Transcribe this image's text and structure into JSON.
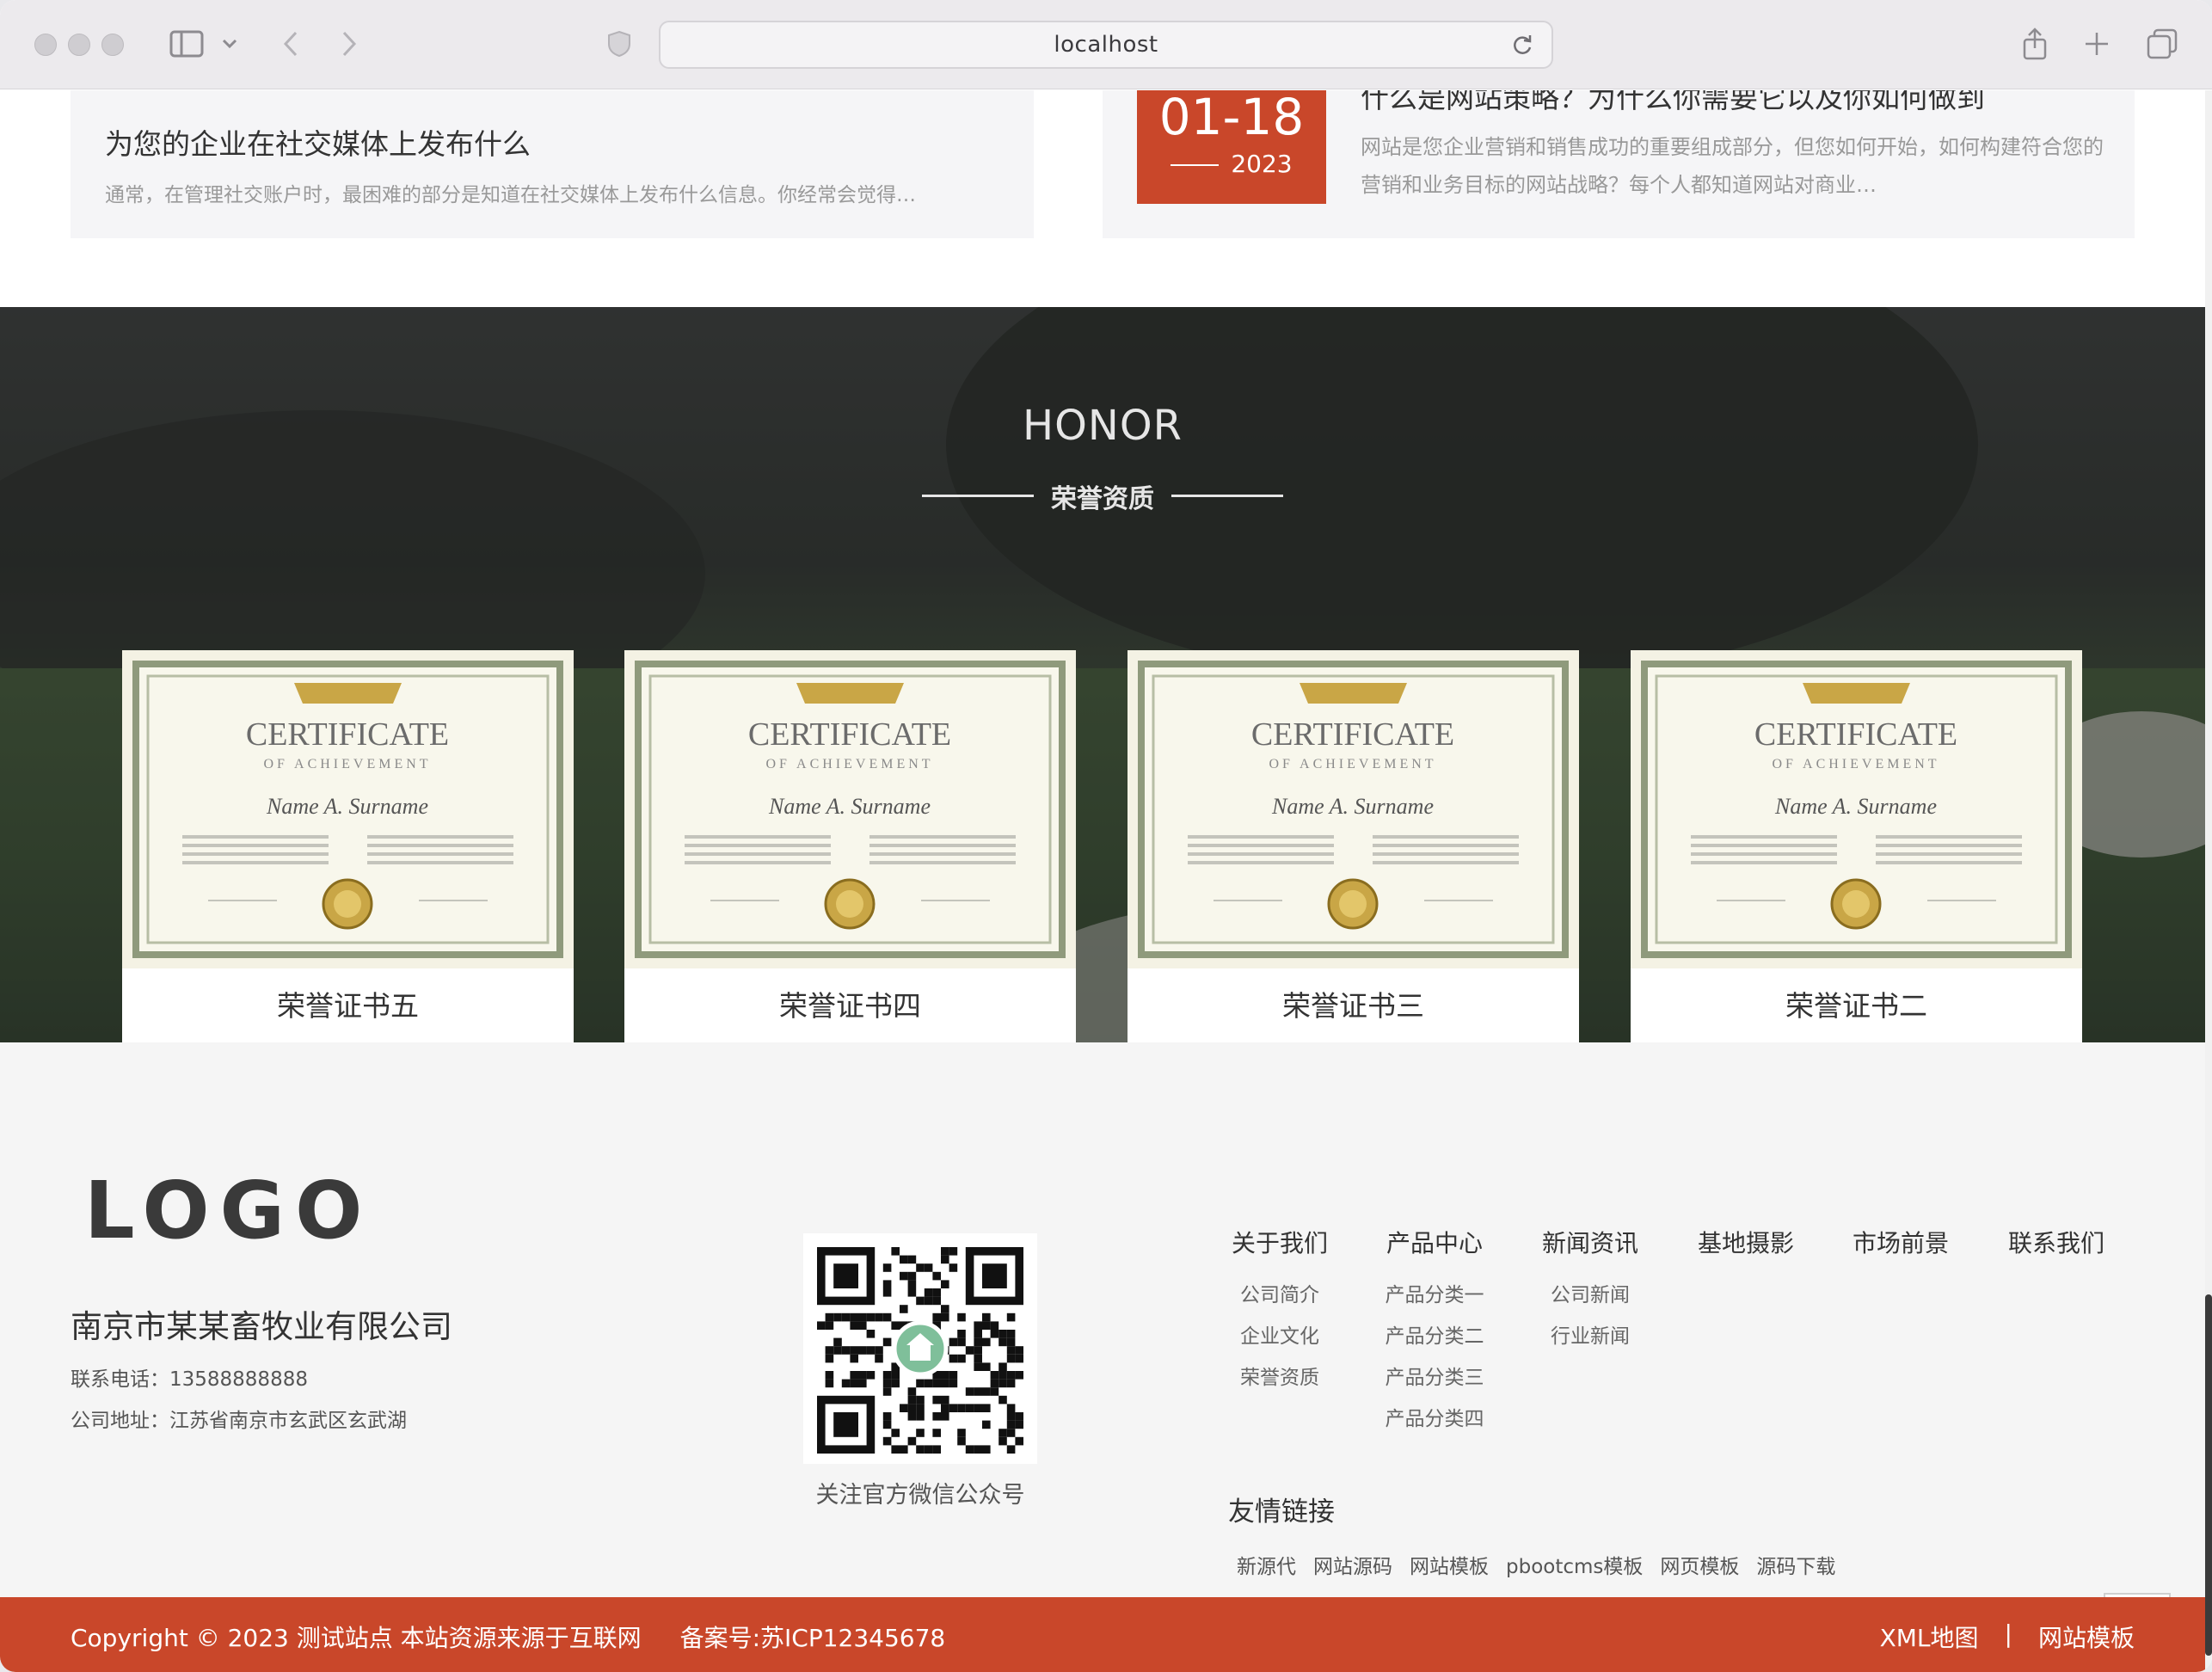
{
  "browser": {
    "url": "localhost"
  },
  "news": {
    "left": {
      "title": "为您的企业在社交媒体上发布什么",
      "desc": "通常，在管理社交账户时，最困难的部分是知道在社交媒体上发布什么信息。你经常会觉得…"
    },
    "right": {
      "date_md": "01-18",
      "date_year": "2023",
      "title": "什么是网站策略？为什么你需要它以及你如何做到",
      "desc": "网站是您企业营销和销售成功的重要组成部分，但您如何开始，如何构建符合您的营销和业务目标的网站战略？每个人都知道网站对商业…"
    }
  },
  "honor": {
    "title_en": "HONOR",
    "title_cn": "荣誉资质",
    "certificates": [
      {
        "label": "荣誉证书五",
        "cert_title": "CERTIFICATE",
        "cert_sub": "OF ACHIEVEMENT",
        "cert_name": "Name A. Surname"
      },
      {
        "label": "荣誉证书四",
        "cert_title": "CERTIFICATE",
        "cert_sub": "OF ACHIEVEMENT",
        "cert_name": "Name A. Surname"
      },
      {
        "label": "荣誉证书三",
        "cert_title": "CERTIFICATE",
        "cert_sub": "OF ACHIEVEMENT",
        "cert_name": "Name A. Surname"
      },
      {
        "label": "荣誉证书二",
        "cert_title": "CERTIFICATE",
        "cert_sub": "OF ACHIEVEMENT",
        "cert_name": "Name A. Surname"
      }
    ]
  },
  "footer": {
    "logo": "LOGO",
    "company": "南京市某某畜牧业有限公司",
    "phone": "联系电话：13588888888",
    "address": "公司地址：江苏省南京市玄武区玄武湖",
    "qr_caption": "关注官方微信公众号",
    "nav": [
      {
        "head": "关于我们",
        "items": [
          "公司简介",
          "企业文化",
          "荣誉资质"
        ]
      },
      {
        "head": "产品中心",
        "items": [
          "产品分类一",
          "产品分类二",
          "产品分类三",
          "产品分类四"
        ]
      },
      {
        "head": "新闻资讯",
        "items": [
          "公司新闻",
          "行业新闻"
        ]
      },
      {
        "head": "基地摄影",
        "items": []
      },
      {
        "head": "市场前景",
        "items": []
      },
      {
        "head": "联系我们",
        "items": []
      }
    ],
    "friends_title": "友情链接",
    "friends": [
      "新源代",
      "网站源码",
      "网站模板",
      "pbootcms模板",
      "网页模板",
      "源码下载"
    ]
  },
  "copyright": {
    "text": "Copyright © 2023 测试站点 本站资源来源于互联网",
    "icp": "备案号:苏ICP12345678",
    "xml_map": "XML地图",
    "separator": "|",
    "template_link": "网站模板"
  },
  "colors": {
    "brand_red": "#c9472a",
    "footer_bg": "#f5f5f5",
    "card_bg": "#f5f5f7"
  }
}
